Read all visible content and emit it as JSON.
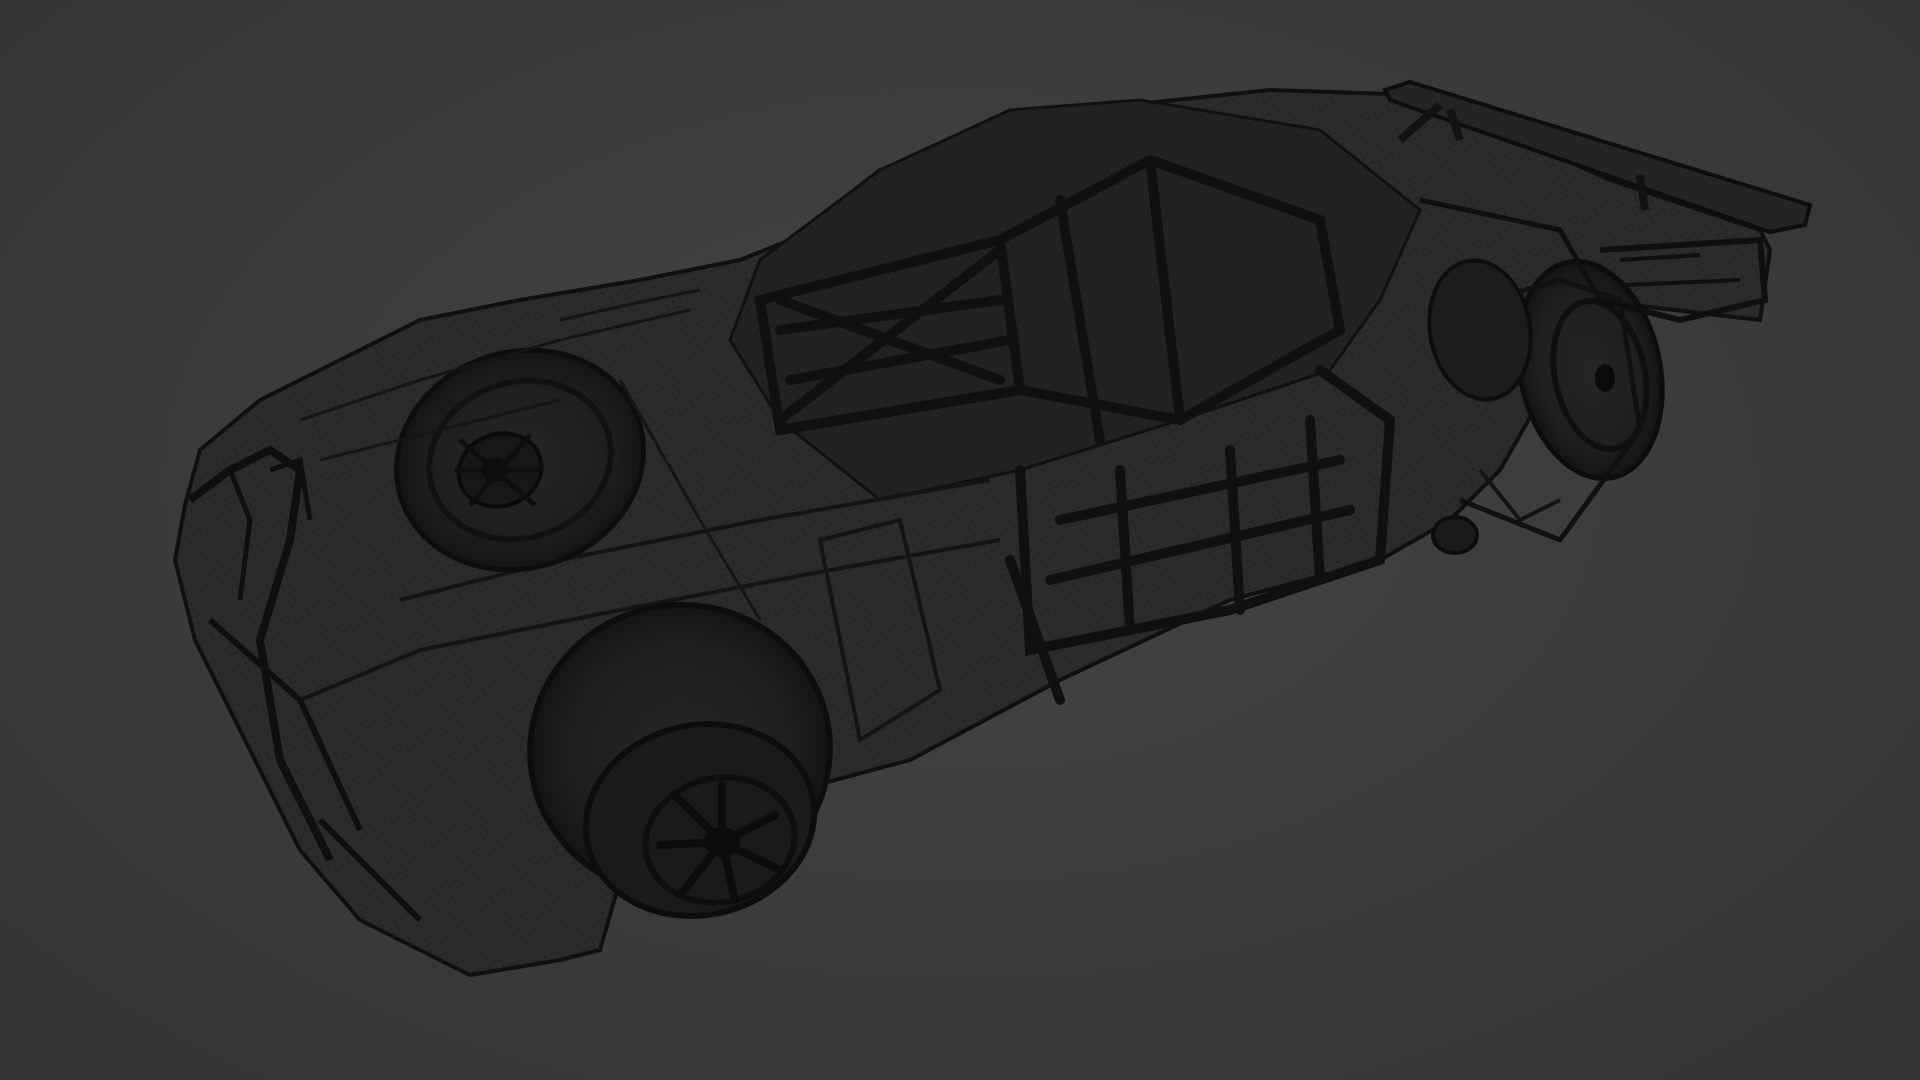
{
  "viewport": {
    "background_color": "#3a3a3a",
    "wire_color": "#111111",
    "mesh_color": "#1e1e1e",
    "shade_color": "#2a2a2a"
  },
  "scene": {
    "subject": "car-wireframe-model",
    "render_mode": "wireframe"
  }
}
